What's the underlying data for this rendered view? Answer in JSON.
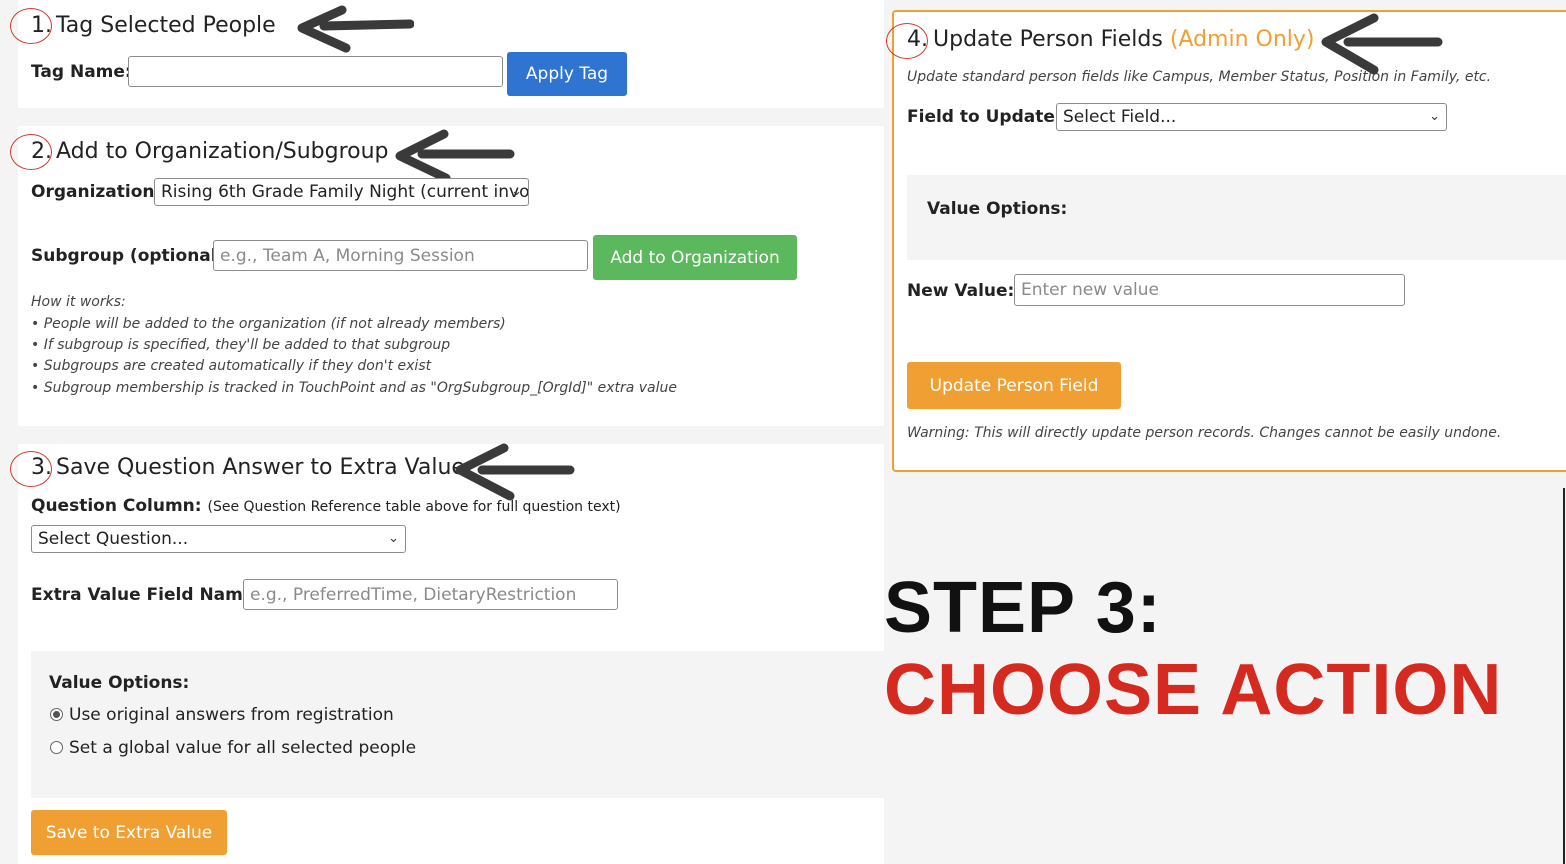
{
  "section1": {
    "number": "1.",
    "title": "Tag Selected People",
    "tag_name_label": "Tag Name:",
    "tag_name_value": "",
    "apply_button": "Apply Tag"
  },
  "section2": {
    "number": "2.",
    "title": "Add to Organization/Subgroup",
    "organization_label": "Organization:",
    "organization_selected": "Rising 6th Grade Family Night (current invo",
    "subgroup_label": "Subgroup (optional):",
    "subgroup_placeholder": "e.g., Team A, Morning Session",
    "add_button": "Add to Organization",
    "how_it_works": [
      "How it works:",
      "• People will be added to the organization (if not already members)",
      "• If subgroup is specified, they'll be added to that subgroup",
      "• Subgroups are created automatically if they don't exist",
      "• Subgroup membership is tracked in TouchPoint and as \"OrgSubgroup_[OrgId]\" extra value"
    ]
  },
  "section3": {
    "number": "3.",
    "title": "Save Question Answer to Extra Value",
    "question_label": "Question Column:",
    "question_note": "(See Question Reference table above for full question text)",
    "question_selected": "Select Question...",
    "extra_field_label": "Extra Value Field Name:",
    "extra_field_placeholder": "e.g., PreferredTime, DietaryRestriction",
    "value_options_label": "Value Options:",
    "options": [
      {
        "label": "Use original answers from registration",
        "selected": true
      },
      {
        "label": "Set a global value for all selected people",
        "selected": false
      }
    ],
    "save_button": "Save to Extra Value"
  },
  "section4": {
    "number": "4.",
    "title": "Update Person Fields",
    "admin_only": "(Admin Only)",
    "description": "Update standard person fields like Campus, Member Status, Position in Family, etc.",
    "field_label": "Field to Update:",
    "field_selected": "Select Field...",
    "value_options_label": "Value Options:",
    "new_value_label": "New Value:",
    "new_value_placeholder": "Enter new value",
    "update_button": "Update Person Field",
    "warning": "Warning: This will directly update person records. Changes cannot be easily undone."
  },
  "overlay": {
    "step_line": "STEP 3:",
    "action_line": "CHOOSE ACTION"
  },
  "colors": {
    "blue_button": "#2f74d0",
    "green_button": "#5cb85c",
    "orange_button": "#f0a033",
    "annotation_red": "#d23a2a",
    "overlay_red": "#d42a20"
  }
}
